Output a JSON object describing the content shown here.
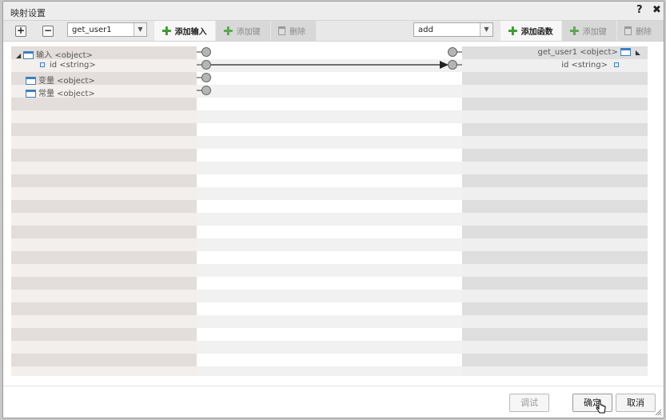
{
  "dialog": {
    "title": "映射设置",
    "help_icon": "?",
    "close_icon": "✖"
  },
  "toolbar": {
    "expand_label": "+",
    "collapse_label": "−",
    "source_select": {
      "value": "get_user1"
    },
    "add_input_label": "添加输入",
    "add_key_left_label": "添加键",
    "delete_left_label": "删除",
    "target_select": {
      "value": "add"
    },
    "add_function_label": "添加函数",
    "add_key_right_label": "添加键",
    "delete_right_label": "删除"
  },
  "source_tree": {
    "items": [
      {
        "label": "输入 <object>",
        "icon": "object-icon",
        "expanded": true
      },
      {
        "label": "id <string>",
        "icon": "field-icon"
      },
      {
        "label": "变量 <object>",
        "icon": "object-icon"
      },
      {
        "label": "常量 <object>",
        "icon": "object-icon"
      }
    ]
  },
  "target_tree": {
    "items": [
      {
        "label": "get_user1 <object>",
        "icon": "object-icon",
        "expanded": true
      },
      {
        "label": "id <string>",
        "icon": "field-icon"
      }
    ]
  },
  "footer": {
    "debug_label": "调试",
    "ok_label": "确定",
    "cancel_label": "取消"
  },
  "colors": {
    "accent_green": "#3c9a2f",
    "icon_blue": "#3d7fc6",
    "connector_gray": "#888888"
  }
}
